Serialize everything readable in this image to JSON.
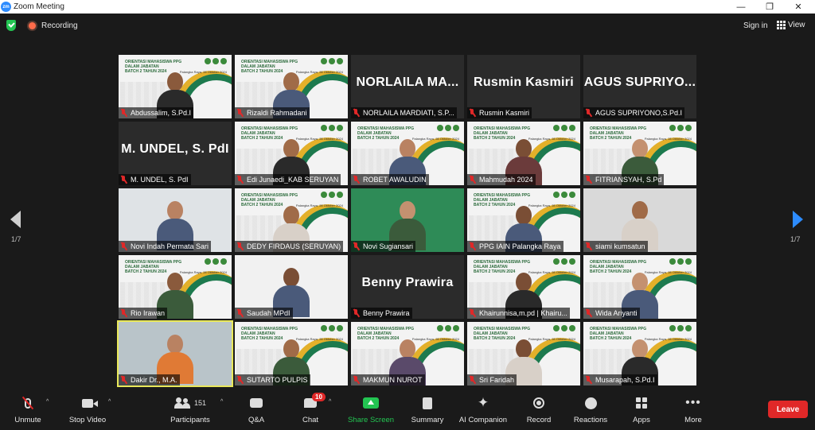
{
  "window": {
    "app_title": "Zoom Meeting",
    "logo_text": "zm",
    "minimize": "—",
    "maximize": "❐",
    "close": "✕"
  },
  "topbar": {
    "recording_label": "Recording",
    "signin_label": "Sign in",
    "view_label": "View"
  },
  "pagination": {
    "left_page": "1/7",
    "right_page": "1/7"
  },
  "banner": {
    "title_line1": "ORIENTASI MAHASISWA PPG DALAM JABATAN",
    "title_line2": "BATCH 2 TAHUN 2024",
    "place_date": "Palangka Raya, 28 Oktober 2024"
  },
  "participants": [
    {
      "name": "Abdussalim, S.Pd.I",
      "tile": "banner"
    },
    {
      "name": "Rizaldi Rahmadani",
      "tile": "banner"
    },
    {
      "name": "NORLAILA MARDIATI, S.P...",
      "tile": "name",
      "display": "NORLAILA MA..."
    },
    {
      "name": "Rusmin Kasmiri",
      "tile": "name",
      "display": "Rusmin Kasmiri"
    },
    {
      "name": "AGUS SUPRIYONO,S.Pd.I",
      "tile": "name",
      "display": "AGUS SUPRIYO..."
    },
    {
      "name": "M. UNDEL, S. PdI",
      "tile": "name",
      "display": "M. UNDEL, S. PdI"
    },
    {
      "name": "Edi Junaedi_KAB SERUYAN",
      "tile": "banner"
    },
    {
      "name": "ROBET AWALUDIN",
      "tile": "banner"
    },
    {
      "name": "Mahmudah 2024",
      "tile": "banner"
    },
    {
      "name": "FITRIANSYAH, S.Pd",
      "tile": "banner"
    },
    {
      "name": "Novi Indah Permata Sari",
      "tile": "video"
    },
    {
      "name": "DEDY FIRDAUS (SERUYAN)",
      "tile": "banner"
    },
    {
      "name": "Novi Sugiansari",
      "tile": "video"
    },
    {
      "name": "PPG IAIN Palangka Raya",
      "tile": "banner"
    },
    {
      "name": "siami kumsatun",
      "tile": "video"
    },
    {
      "name": "Rio Irawan",
      "tile": "banner"
    },
    {
      "name": "Saudah MPdI",
      "tile": "video"
    },
    {
      "name": "Benny Prawira",
      "tile": "name",
      "display": "Benny Prawira"
    },
    {
      "name": "Khairunnisa,m.pd | Khairu...",
      "tile": "banner"
    },
    {
      "name": "Wida Ariyanti",
      "tile": "banner"
    },
    {
      "name": "Dakir Dr., M.A.",
      "tile": "video",
      "active": true
    },
    {
      "name": "SUTARTO PULPIS",
      "tile": "banner"
    },
    {
      "name": "MAKMUN NUROT",
      "tile": "banner"
    },
    {
      "name": "Sri Faridah",
      "tile": "banner"
    },
    {
      "name": "Musarapah, S.Pd.I",
      "tile": "banner"
    }
  ],
  "toolbar": {
    "unmute": "Unmute",
    "stop_video": "Stop Video",
    "participants": "Participants",
    "participants_count": "151",
    "qa": "Q&A",
    "chat": "Chat",
    "chat_badge": "10",
    "share_screen": "Share Screen",
    "summary": "Summary",
    "ai_companion": "AI Companion",
    "record": "Record",
    "reactions": "Reactions",
    "apps": "Apps",
    "more": "More",
    "leave": "Leave",
    "caret": "^",
    "spark_glyph": "✦",
    "more_glyph": "•••"
  },
  "colors": {
    "accent": "#2d8cff",
    "share_green": "#23c552",
    "leave_red": "#e02828",
    "active_speaker": "#e9e85a",
    "banner_green": "#1d7a4e",
    "banner_gold": "#e3b02a"
  }
}
